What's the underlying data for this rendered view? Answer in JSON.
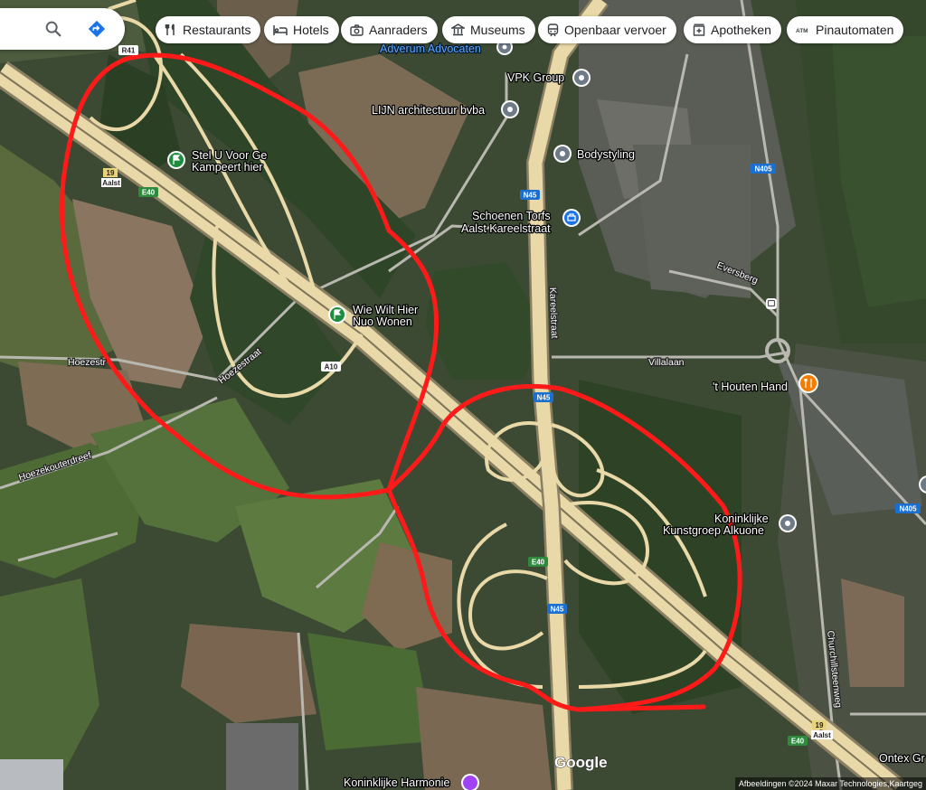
{
  "search": {
    "search_icon": "search-icon",
    "directions_icon": "directions-icon"
  },
  "chips": [
    {
      "label": "Restaurants",
      "icon": "restaurant-icon"
    },
    {
      "label": "Hotels",
      "icon": "bed-icon"
    },
    {
      "label": "Aanraders",
      "icon": "camera-icon"
    },
    {
      "label": "Museums",
      "icon": "museum-icon"
    },
    {
      "label": "Openbaar vervoer",
      "icon": "transit-icon"
    },
    {
      "label": "Apotheken",
      "icon": "pharmacy-icon"
    },
    {
      "label": "Pinautomaten",
      "icon": "atm-icon"
    }
  ],
  "places": {
    "adverum": "Adverum Advocaten",
    "vpk": "VPK Group",
    "lijn": "LIJN architectuur bvba",
    "bodystyling": "Bodystyling",
    "schoenen_1": "Schoenen Torfs",
    "schoenen_2": "Aalst Kareelstraat",
    "stel_1": "Stel U Voor Ge",
    "stel_2": "Kampeert hier",
    "wie_1": "Wie Wilt Hier",
    "wie_2": "Nuo Wonen",
    "houten_hand": "'t Houten Hand",
    "kunstgroep_1": "Koninklijke",
    "kunstgroep_2": "Kunstgroep Alkuone",
    "harmonie": "Koninklijke Harmonie",
    "ontex": "Ontex Gr"
  },
  "roads": {
    "hoezestraat": "Hoezestraat",
    "hoezestraat_west": "Hoezestr",
    "hoezekouterdreef": "Hoezekouterdreef",
    "kareelstraat": "Kareelstraat",
    "villalaan": "Villalaan",
    "eversberg": "Eversberg",
    "churchillsteenweg": "Churchillsteenweg"
  },
  "shields": {
    "e40": "E40",
    "a10": "A10",
    "n45": "N45",
    "n405": "N405",
    "r41": "R41",
    "exit19": "19",
    "aalst": "Aalst"
  },
  "branding": {
    "google": "Google",
    "attribution": "Afbeeldingen ©2024 Maxar Technologies,Kaartgeg"
  },
  "colors": {
    "annotation": "#ff1a1a",
    "highway": "#e9d9a8",
    "place_pin": "#6e7b87",
    "park_pin": "#1e8e3e",
    "shop_pin": "#1a73e8",
    "food_pin": "#f57c00",
    "harmonie_pin": "#a142f4"
  }
}
